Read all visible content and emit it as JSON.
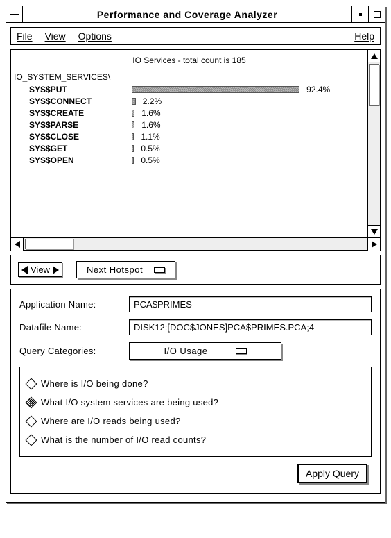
{
  "window": {
    "title": "Performance and Coverage Analyzer"
  },
  "menubar": {
    "file": "File",
    "view": "View",
    "options": "Options",
    "help": "Help"
  },
  "chart": {
    "header": "IO Services - total count is 185",
    "group": "IO_SYSTEM_SERVICES\\"
  },
  "chart_data": {
    "type": "bar",
    "title": "IO Services - total count is 185",
    "xlabel": "",
    "ylabel": "percent",
    "ylim": [
      0,
      100
    ],
    "categories": [
      "SYS$PUT",
      "SYS$CONNECT",
      "SYS$CREATE",
      "SYS$PARSE",
      "SYS$CLOSE",
      "SYS$GET",
      "SYS$OPEN"
    ],
    "values": [
      92.4,
      2.2,
      1.6,
      1.6,
      1.1,
      0.5,
      0.5
    ],
    "value_labels": [
      "92.4%",
      "2.2%",
      "1.6%",
      "1.6%",
      "1.1%",
      "0.5%",
      "0.5%"
    ]
  },
  "nav": {
    "view_label": "View",
    "next_hotspot": "Next Hotspot"
  },
  "form": {
    "app_label": "Application Name:",
    "app_value": "PCA$PRIMES",
    "data_label": "Datafile Name:",
    "data_value": "DISK12:[DOC$JONES]PCA$PRIMES.PCA;4",
    "query_cat_label": "Query Categories:",
    "query_cat_value": "I/O Usage"
  },
  "queries": [
    {
      "text": "Where is I/O being done?",
      "selected": false
    },
    {
      "text": "What I/O system services are being used?",
      "selected": true
    },
    {
      "text": "Where are I/O reads being used?",
      "selected": false
    },
    {
      "text": "What is the number of I/O read counts?",
      "selected": false
    }
  ],
  "apply": {
    "label": "Apply Query"
  }
}
